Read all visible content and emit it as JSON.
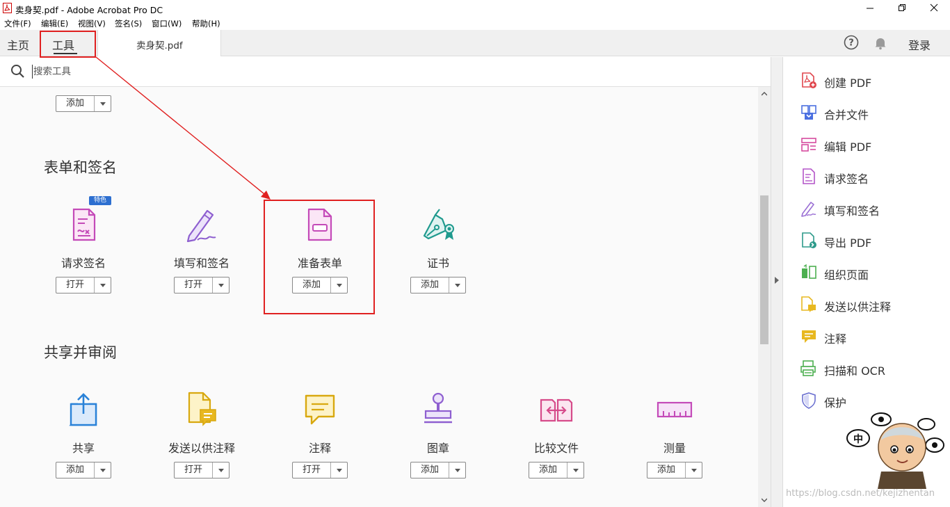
{
  "window": {
    "title": "卖身契.pdf - Adobe Acrobat Pro DC"
  },
  "menu": [
    "文件(F)",
    "编辑(E)",
    "视图(V)",
    "签名(S)",
    "窗口(W)",
    "帮助(H)"
  ],
  "tabs": {
    "home": "主页",
    "tools": "工具",
    "document": "卖身契.pdf"
  },
  "header": {
    "login": "登录"
  },
  "search": {
    "placeholder": "搜索工具"
  },
  "top_tool": {
    "button": "添加"
  },
  "sections": [
    {
      "title": "表单和签名",
      "tools": [
        {
          "label": "请求签名",
          "button": "打开",
          "badge": "特色",
          "icon": "request-signature-icon"
        },
        {
          "label": "填写和签名",
          "button": "打开",
          "icon": "fill-sign-icon"
        },
        {
          "label": "准备表单",
          "button": "添加",
          "icon": "prepare-form-icon"
        },
        {
          "label": "证书",
          "button": "添加",
          "icon": "certificate-icon"
        }
      ]
    },
    {
      "title": "共享并审阅",
      "tools": [
        {
          "label": "共享",
          "button": "添加",
          "icon": "share-icon"
        },
        {
          "label": "发送以供注释",
          "button": "打开",
          "icon": "send-comments-icon"
        },
        {
          "label": "注释",
          "button": "打开",
          "icon": "comment-icon"
        },
        {
          "label": "图章",
          "button": "添加",
          "icon": "stamp-icon"
        },
        {
          "label": "比较文件",
          "button": "添加",
          "icon": "compare-icon"
        },
        {
          "label": "测量",
          "button": "添加",
          "icon": "measure-icon"
        }
      ]
    }
  ],
  "right_panel": [
    {
      "label": "创建 PDF",
      "icon": "create-pdf-icon",
      "color": "#e0464d"
    },
    {
      "label": "合并文件",
      "icon": "combine-files-icon",
      "color": "#4a6fe0"
    },
    {
      "label": "编辑 PDF",
      "icon": "edit-pdf-icon",
      "color": "#d64b9e"
    },
    {
      "label": "请求签名",
      "icon": "request-signature-icon",
      "color": "#b455c8"
    },
    {
      "label": "填写和签名",
      "icon": "fill-sign-icon",
      "color": "#9a6fd4"
    },
    {
      "label": "导出 PDF",
      "icon": "export-pdf-icon",
      "color": "#2d9a8a"
    },
    {
      "label": "组织页面",
      "icon": "organize-pages-icon",
      "color": "#4caf50"
    },
    {
      "label": "发送以供注释",
      "icon": "send-comments-icon",
      "color": "#e8b820"
    },
    {
      "label": "注释",
      "icon": "comment-icon",
      "color": "#e8b820"
    },
    {
      "label": "扫描和 OCR",
      "icon": "scan-ocr-icon",
      "color": "#4caf50"
    },
    {
      "label": "保护",
      "icon": "protect-icon",
      "color": "#6a6fd0"
    }
  ],
  "watermark": "https://blog.csdn.net/kejizhentan",
  "colors": {
    "annotation_red": "#e02020",
    "badge_blue": "#2d6fd0"
  }
}
